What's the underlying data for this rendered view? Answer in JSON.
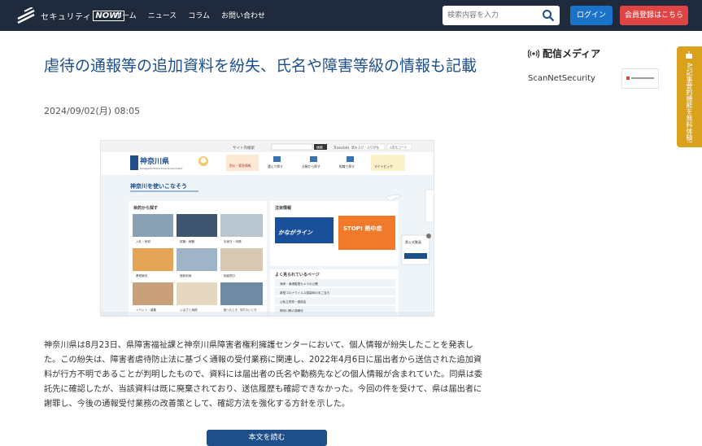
{
  "header": {
    "logo_text": "セキュリティ",
    "logo_now": "NOW!",
    "nav": [
      "ホーム",
      "ニュース",
      "コラム",
      "お問い合わせ"
    ],
    "search_placeholder": "検索内容を入力",
    "login_label": "ログイン",
    "register_label": "会員登録はこちら"
  },
  "article": {
    "title": "虐待の通報等の追加資料を紛失、氏名や障害等級の情報も記載",
    "date": "2024/09/02(月) 08:05",
    "body": "神奈川県は8月23日、県障害福祉課と神奈川県障害者権利擁護センターにおいて、個人情報が紛失したことを発表した。この紛失は、障害者虐待防止法に基づく通報の受付業務に関連し、2022年4月6日に届出者から送信された追加資料が行方不明であることが判明したもので、資料には届出者の氏名や勤務先などの個人情報が含まれていた。同県は委託先に確認したが、当該資料は既に廃棄されており、送信履歴も確認できなかった。今回の件を受けて、県は届出者に謝罪し、今後の通報受付業務の改善策として、確認方法を強化する方針を示した。",
    "readmore_label": "本文を読む"
  },
  "hero": {
    "site_map": "サイト内検索",
    "search_btn": "検索",
    "translate": "Translate",
    "furigana": "読み上げ・ふりがな",
    "two_d": "2次元コード",
    "pref_name": "神奈川県",
    "pref_sub": "Kanagawa Prefectural Government",
    "tabs": [
      "防災・緊急情報",
      "選んで探す",
      "分類から探す",
      "組織で探す",
      "マイトピック"
    ],
    "use_heading": "神奈川を使いこなそう",
    "purpose_heading": "目的から探す",
    "categories": [
      "入札・売却",
      "試験・就職",
      "手続き・申請",
      "県税案内",
      "施設利用",
      "相談窓口",
      "イベント・募集",
      "ふるさと納税",
      "困ったとき、知りたいとき"
    ],
    "notice_heading": "注目情報",
    "banner1": "かながライン",
    "banner2": "STOP! 熱中症",
    "popular_heading": "よく見られているページ",
    "popular": [
      "海岸・漁港監視カメラの公開",
      "新型コロナウイルス感染時の手ご当方",
      "公私立同窓・相談会",
      "神奈川県の温暖化"
    ],
    "line_label": "県公式動画"
  },
  "sidebar": {
    "media_heading": "配信メディア",
    "media_item": "ScanNetSecurity",
    "tab_text": "AI記事要約機能を無料体験!"
  }
}
